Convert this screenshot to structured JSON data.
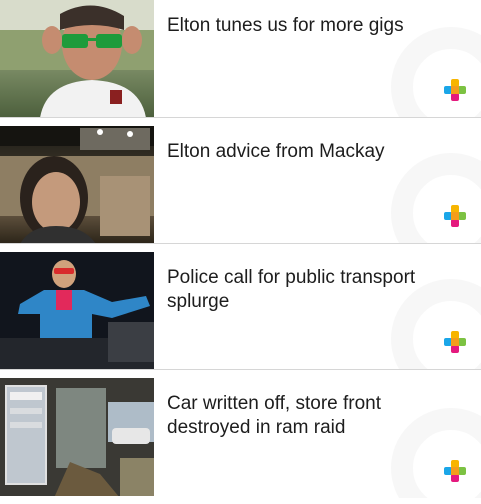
{
  "articles": [
    {
      "title": "Elton tunes us for more gigs",
      "thumb_alt": "photo-man-green-glasses"
    },
    {
      "title": "Elton advice from Mackay",
      "thumb_alt": "photo-woman-concert-crowd"
    },
    {
      "title": "Police call for public transport splurge",
      "thumb_alt": "photo-elton-on-stage"
    },
    {
      "title": "Car written off, store front destroyed in ram raid",
      "thumb_alt": "photo-damaged-store-front"
    }
  ],
  "colors": {
    "plus_yellow": "#f7b500",
    "plus_blue": "#1aa6e8",
    "plus_magenta": "#e4197e",
    "plus_green": "#7cc242"
  }
}
